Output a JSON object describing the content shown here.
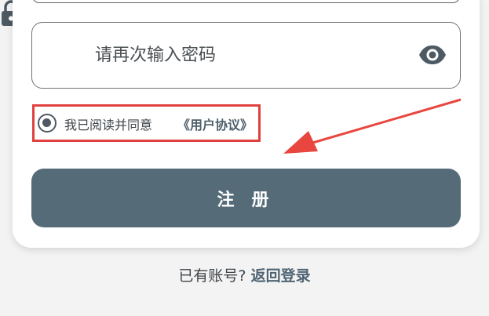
{
  "form": {
    "confirm_password": {
      "placeholder": "请再次输入密码",
      "value": "",
      "lock_icon": "lock-icon",
      "visibility_icon": "eye-icon"
    },
    "agreement": {
      "checked": true,
      "text": "我已阅读并同意",
      "link": "《用户协议》"
    },
    "register_label": "注 册"
  },
  "footer": {
    "prefix": "已有账号?",
    "link": "返回登录"
  },
  "colors": {
    "primary": "#566b78",
    "highlight_box": "#e0413f",
    "arrow": "#e8463f",
    "background": "#f3f3f3",
    "card": "#ffffff"
  }
}
